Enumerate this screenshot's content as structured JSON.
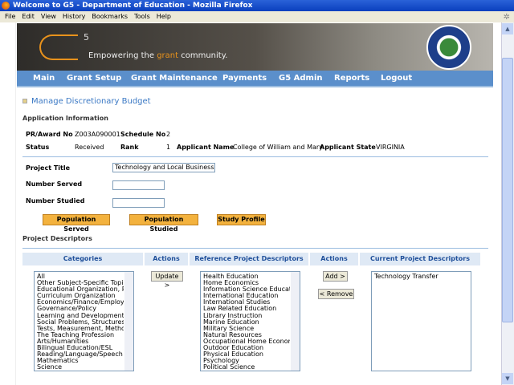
{
  "window": {
    "title": "Welcome to G5 - Department of Education - Mozilla Firefox"
  },
  "menu": [
    "File",
    "Edit",
    "View",
    "History",
    "Bookmarks",
    "Tools",
    "Help"
  ],
  "banner": {
    "logo": "G",
    "superscript": "5",
    "tagline_pre": "Empowering the ",
    "tagline_accent": "grant",
    "tagline_post": " community."
  },
  "nav": [
    "Main",
    "Grant Setup",
    "Grant Maintenance",
    "Payments",
    "G5 Admin",
    "Reports",
    "Logout"
  ],
  "page_title": "Manage Discretionary Budget",
  "app_info": {
    "heading": "Application Information",
    "pr_award_label": "PR/Award No",
    "pr_award": "Z003A090001",
    "schedule_label": "Schedule No",
    "schedule": "2",
    "status_label": "Status",
    "status": "Received",
    "rank_label": "Rank",
    "rank": "1",
    "applicant_name_label": "Applicant Name",
    "applicant_name": "College of William and Mary",
    "applicant_state_label": "Applicant State",
    "applicant_state": "VIRGINIA"
  },
  "form": {
    "project_title_label": "Project Title",
    "project_title": "Technology and Local Business",
    "number_served_label": "Number Served",
    "number_served": "",
    "number_studied_label": "Number Studied",
    "number_studied": ""
  },
  "buttons": {
    "population_served": "Population Served",
    "population_studied": "Population Studied",
    "study_profile": "Study Profile",
    "update": "Update >",
    "add": "Add >",
    "remove": "< Remove"
  },
  "descriptors": {
    "heading": "Project Descriptors",
    "headers": [
      "Categories",
      "Actions",
      "Reference Project Descriptors",
      "Actions",
      "Current Project Descriptors"
    ],
    "categories": [
      "All",
      "Other Subject-Specific Topics",
      "Educational Organization, Procedures",
      "Curriculum Organization",
      "Economics/Finance/Employment",
      "Governance/Policy",
      "Learning and Development",
      "Social Problems, Structures, and",
      "Tests, Measurement, Methodology",
      "The Teaching Profession",
      "Arts/Humanities",
      "Bilingual Education/ESL",
      "Reading/Language/Speech",
      "Mathematics",
      "Science"
    ],
    "reference": [
      "Health Education",
      "Home Economics",
      "Information Science Education",
      "International Education",
      "International Studies",
      "Law Related Education",
      "Library Instruction",
      "Marine Education",
      "Military Science",
      "Natural Resources",
      "Occupational Home Economics",
      "Outdoor Education",
      "Physical Education",
      "Psychology",
      "Political Science"
    ],
    "current": [
      "Technology Transfer"
    ]
  }
}
